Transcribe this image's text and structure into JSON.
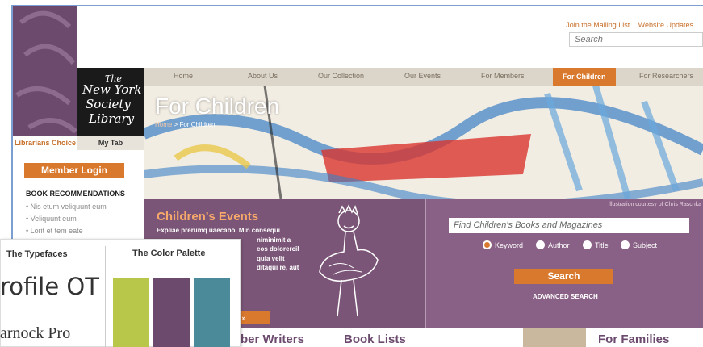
{
  "utility": {
    "mailing": "Join the Mailing List",
    "sep": "|",
    "updates": "Website Updates"
  },
  "search_top": {
    "placeholder": "Search"
  },
  "logo": {
    "l1": "The",
    "l2": "New York",
    "l3": "Society",
    "l4": "Library"
  },
  "nav": [
    "Home",
    "About Us",
    "Our Collection",
    "Our Events",
    "For Members",
    "For Children",
    "For Researchers"
  ],
  "hero": {
    "title": "For Children",
    "crumb_home": "Home",
    "crumb_sep": " > ",
    "crumb_current": "For Children"
  },
  "tabs": {
    "t1": "Librarians Choice",
    "t2": "My Tab"
  },
  "sidebar": {
    "login": "Member Login",
    "recs_title": "BOOK RECOMMENDATIONS",
    "recs": [
      "• Nis etum veliquunt eum",
      "• Veliquunt eum",
      "• Lorit et tem eate"
    ]
  },
  "events": {
    "title": "Children's Events",
    "lines": [
      "Expliae prerumq uaecabo. Min consequi",
      "niminimit a",
      "eos dolorercil",
      "quia velit",
      "ditaqui re, aut"
    ],
    "more": "s »"
  },
  "credit": "Illustration courtesy of Chris Raschka",
  "find": {
    "placeholder": "Find Children's Books and Magazines",
    "options": [
      "Keyword",
      "Author",
      "Title",
      "Subject"
    ],
    "search_btn": "Search",
    "advanced": "ADVANCED SEARCH"
  },
  "bottom": {
    "c1": "ber Writers",
    "c2": "Book Lists",
    "c3": "For Families"
  },
  "card": {
    "typefaces": "The Typefaces",
    "palette": "The Color Palette",
    "font1": "rofile OT",
    "font2": "arnock Pro",
    "swatches": [
      "#b8c64a",
      "#6b4a6e",
      "#4a8a99"
    ]
  }
}
